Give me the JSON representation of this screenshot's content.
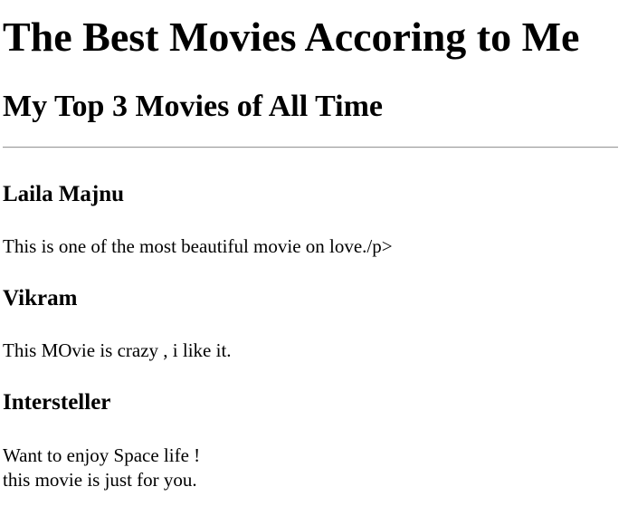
{
  "heading": "The Best Movies Accoring to Me",
  "subheading": "My Top 3 Movies of All Time",
  "movies": [
    {
      "title": "Laila Majnu",
      "lines": [
        "This is one of the most beautiful movie on love./p>"
      ]
    },
    {
      "title": "Vikram",
      "lines": [
        "This MOvie is crazy , i like it."
      ]
    },
    {
      "title": "Intersteller",
      "lines": [
        "Want to enjoy Space life !",
        "this movie is just for you."
      ]
    }
  ]
}
